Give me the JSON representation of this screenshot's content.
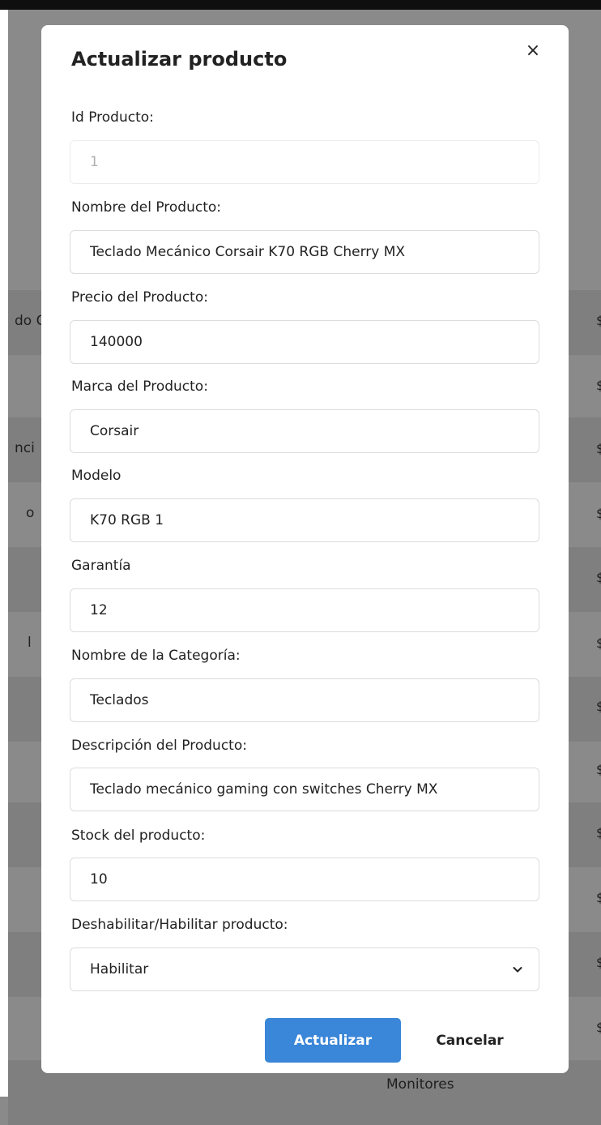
{
  "background": {
    "left_fragments": [
      "do G",
      "nci",
      "o",
      "l"
    ],
    "right_marker": "$",
    "bottom_text": "Monitores"
  },
  "modal": {
    "title": "Actualizar producto",
    "close_symbol": "×",
    "fields": {
      "id": {
        "label": "Id Producto:",
        "value": "1"
      },
      "name": {
        "label": "Nombre del Producto:",
        "value": "Teclado Mecánico Corsair K70 RGB Cherry MX"
      },
      "price": {
        "label": "Precio del Producto:",
        "value": "140000"
      },
      "brand": {
        "label": "Marca del Producto:",
        "value": "Corsair"
      },
      "model": {
        "label": "Modelo",
        "value": "K70 RGB 1"
      },
      "warranty": {
        "label": "Garantía",
        "value": "12"
      },
      "category": {
        "label": "Nombre de la Categoría:",
        "value": "Teclados"
      },
      "description": {
        "label": "Descripción del Producto:",
        "value": "Teclado mecánico gaming con switches Cherry MX"
      },
      "stock": {
        "label": "Stock del producto:",
        "value": "10"
      },
      "status": {
        "label": "Deshabilitar/Habilitar producto:",
        "value": "Habilitar"
      }
    },
    "buttons": {
      "update": "Actualizar",
      "cancel": "Cancelar"
    }
  },
  "colors": {
    "primary": "#3a86d8",
    "overlay": "#8a8a8a"
  }
}
